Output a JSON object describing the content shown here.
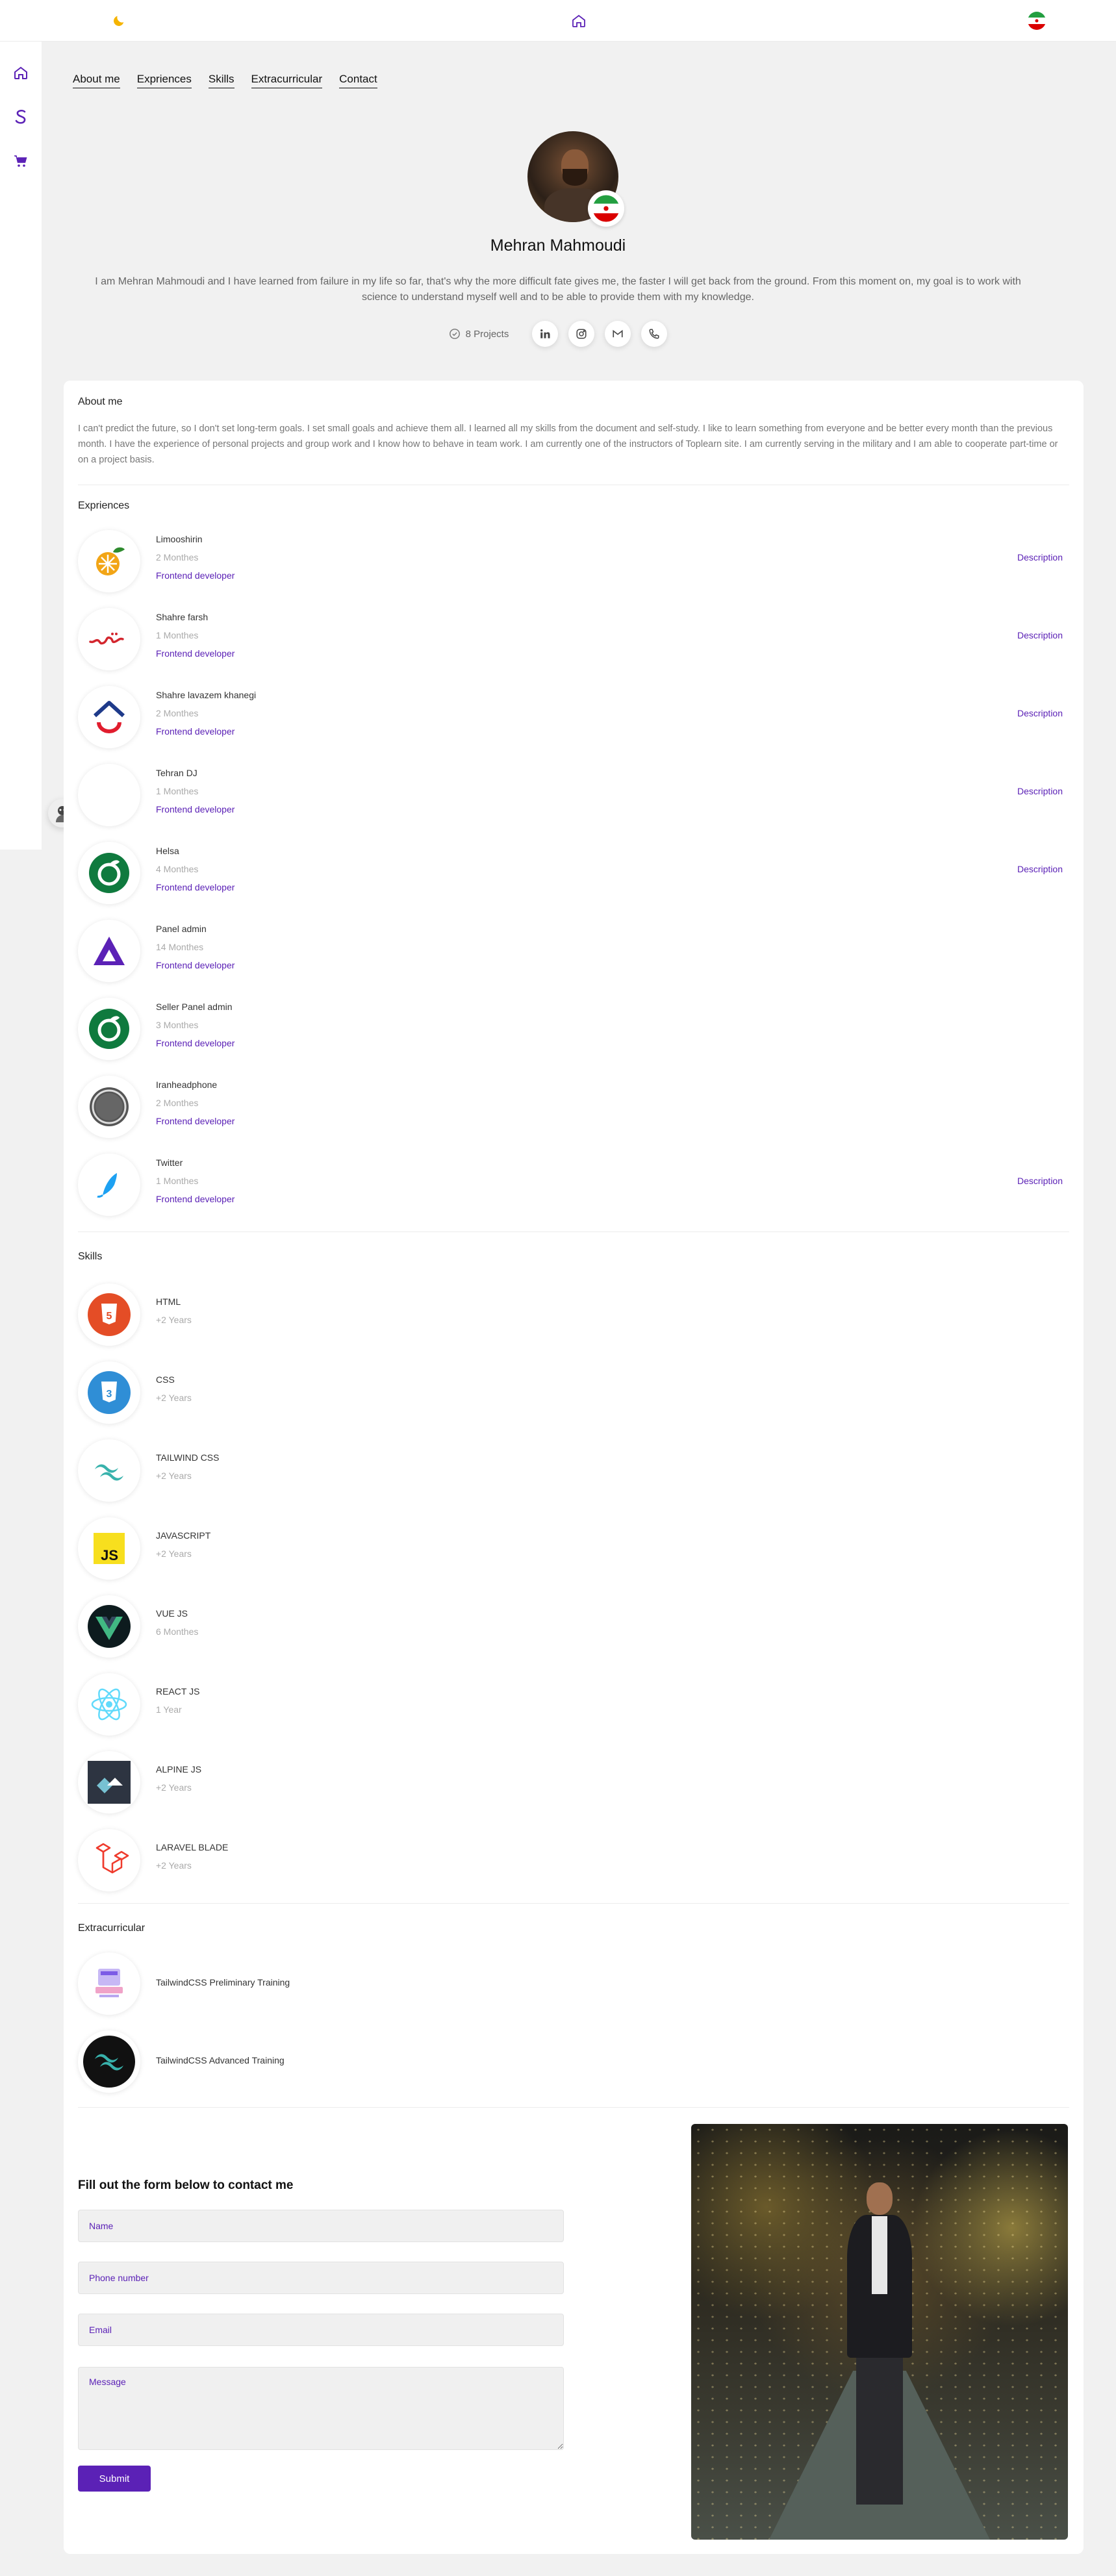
{
  "topbar": {
    "left_icon": "moon-icon",
    "center_icon": "home-icon",
    "right_icon": "iran-flag-icon"
  },
  "sidebar": {
    "items": [
      {
        "icon": "home-icon"
      },
      {
        "icon": "s-logo-icon"
      },
      {
        "icon": "cart-icon"
      }
    ]
  },
  "tabs": [
    {
      "label": "About me"
    },
    {
      "label": "Expriences"
    },
    {
      "label": "Skills"
    },
    {
      "label": "Extracurricular"
    },
    {
      "label": "Contact"
    }
  ],
  "profile": {
    "name": "Mehran Mahmoudi",
    "intro": "I am Mehran Mahmoudi and I have learned from failure in my life so far, that's why the more difficult fate gives me, the faster I will get back from the ground. From this moment on, my goal is to work with science to understand myself well and to be able to provide them with my knowledge.",
    "projects_label": "8 Projects",
    "social": [
      {
        "icon": "linkedin-icon"
      },
      {
        "icon": "instagram-icon"
      },
      {
        "icon": "gmail-icon"
      },
      {
        "icon": "phone-icon"
      }
    ]
  },
  "about": {
    "title": "About me",
    "text": "I can't predict the future, so I don't set long-term goals. I set small goals and achieve them all. I learned all my skills from the document and self-study. I like to learn something from everyone and be better every month than the previous month. I have the experience of personal projects and group work and I know how to behave in team work. I am currently one of the instructors of Toplearn site. I am currently serving in the military and I am able to cooperate part-time or on a project basis."
  },
  "experiences": {
    "title": "Expriences",
    "items": [
      {
        "title": "Limooshirin",
        "duration": "2 Monthes",
        "role": "Frontend developer",
        "description": "Description"
      },
      {
        "title": "Shahre farsh",
        "duration": "1 Monthes",
        "role": "Frontend developer",
        "description": "Description"
      },
      {
        "title": "Shahre lavazem khanegi",
        "duration": "2 Monthes",
        "role": "Frontend developer",
        "description": "Description"
      },
      {
        "title": "Tehran DJ",
        "duration": "1 Monthes",
        "role": "Frontend developer",
        "description": "Description"
      },
      {
        "title": "Helsa",
        "duration": "4 Monthes",
        "role": "Frontend developer",
        "description": "Description"
      },
      {
        "title": "Panel admin",
        "duration": "14 Monthes",
        "role": "Frontend developer",
        "description": ""
      },
      {
        "title": "Seller Panel admin",
        "duration": "3 Monthes",
        "role": "Frontend developer",
        "description": ""
      },
      {
        "title": "Iranheadphone",
        "duration": "2 Monthes",
        "role": "Frontend developer",
        "description": ""
      },
      {
        "title": "Twitter",
        "duration": "1 Monthes",
        "role": "Frontend developer",
        "description": "Description"
      }
    ]
  },
  "skills": {
    "title": "Skills",
    "items": [
      {
        "title": "HTML",
        "duration": "+2 Years"
      },
      {
        "title": "CSS",
        "duration": "+2 Years"
      },
      {
        "title": "TAILWIND CSS",
        "duration": "+2 Years"
      },
      {
        "title": "JAVASCRIPT",
        "duration": "+2 Years"
      },
      {
        "title": "VUE JS",
        "duration": "6 Monthes"
      },
      {
        "title": "REACT JS",
        "duration": "1 Year"
      },
      {
        "title": "ALPINE JS",
        "duration": "+2 Years"
      },
      {
        "title": "LARAVEL BLADE",
        "duration": "+2 Years"
      }
    ]
  },
  "extracurricular": {
    "title": "Extracurricular",
    "items": [
      {
        "title": "TailwindCSS Preliminary Training"
      },
      {
        "title": "TailwindCSS Advanced Training"
      }
    ]
  },
  "contact": {
    "title": "Fill out the form below to contact me",
    "name_placeholder": "Name",
    "phone_placeholder": "Phone number",
    "email_placeholder": "Email",
    "message_placeholder": "Message",
    "submit_label": "Submit"
  },
  "colors": {
    "accent": "#5b21b6",
    "background": "#f1f1f1",
    "card": "#ffffff"
  }
}
